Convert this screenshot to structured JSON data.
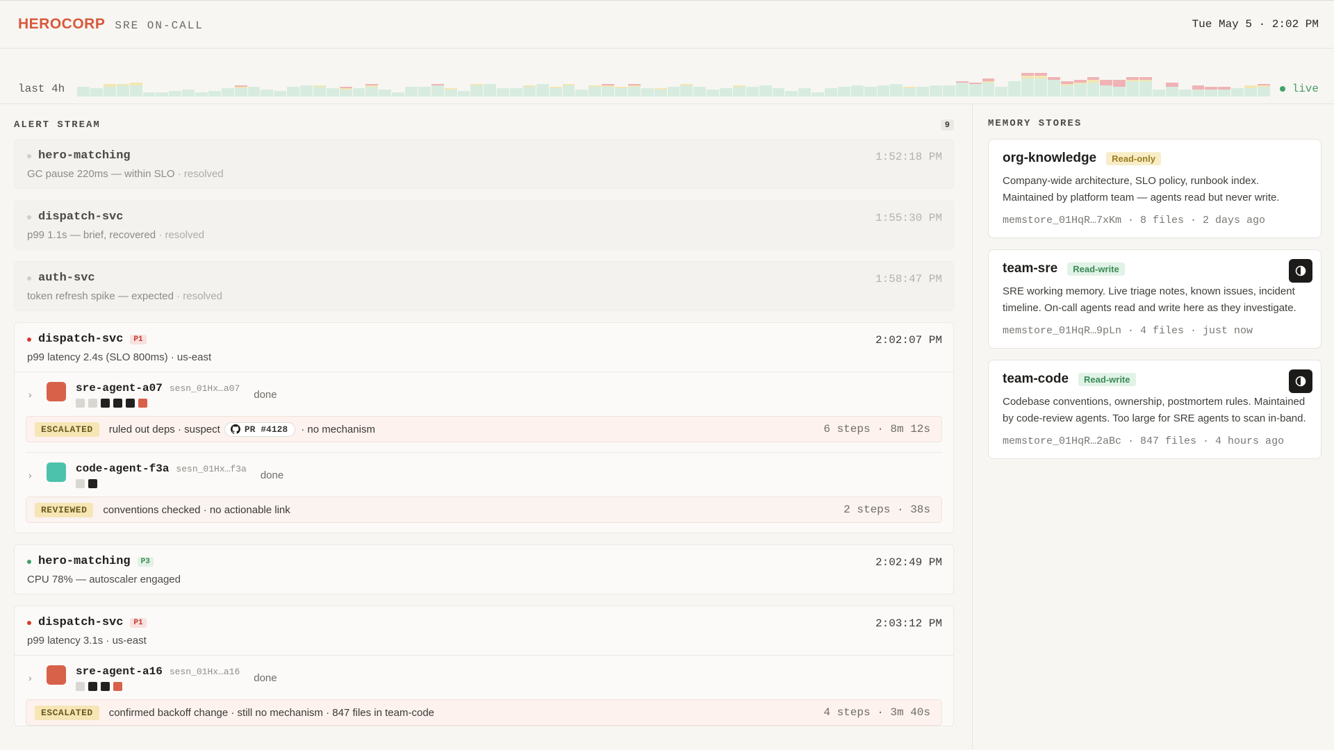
{
  "header": {
    "brand": "HEROCORP",
    "subtitle": "SRE ON-CALL",
    "clock": "Tue May 5 · 2:02 PM"
  },
  "sparkline": {
    "label": "last 4h",
    "live_label": "live",
    "colors": {
      "ok": "#d7ecdf",
      "warn": "#f3e6b3",
      "crit": "#efb3b6"
    },
    "bars": [
      [
        14,
        0,
        0
      ],
      [
        12,
        0,
        0
      ],
      [
        14,
        4,
        0
      ],
      [
        16,
        2,
        0
      ],
      [
        16,
        4,
        0
      ],
      [
        6,
        0,
        0
      ],
      [
        6,
        0,
        0
      ],
      [
        8,
        0,
        0
      ],
      [
        10,
        0,
        0
      ],
      [
        6,
        0,
        0
      ],
      [
        8,
        0,
        0
      ],
      [
        12,
        0,
        0
      ],
      [
        12,
        2,
        2
      ],
      [
        14,
        0,
        0
      ],
      [
        10,
        0,
        0
      ],
      [
        8,
        0,
        0
      ],
      [
        14,
        0,
        0
      ],
      [
        16,
        0,
        0
      ],
      [
        14,
        2,
        0
      ],
      [
        12,
        0,
        0
      ],
      [
        10,
        2,
        2
      ],
      [
        12,
        0,
        0
      ],
      [
        14,
        2,
        2
      ],
      [
        10,
        0,
        0
      ],
      [
        6,
        0,
        0
      ],
      [
        14,
        0,
        0
      ],
      [
        14,
        0,
        0
      ],
      [
        16,
        0,
        2
      ],
      [
        10,
        2,
        0
      ],
      [
        8,
        0,
        0
      ],
      [
        16,
        2,
        0
      ],
      [
        18,
        0,
        0
      ],
      [
        12,
        0,
        0
      ],
      [
        12,
        0,
        0
      ],
      [
        14,
        2,
        0
      ],
      [
        18,
        0,
        0
      ],
      [
        12,
        2,
        0
      ],
      [
        16,
        2,
        0
      ],
      [
        10,
        0,
        0
      ],
      [
        14,
        2,
        0
      ],
      [
        14,
        2,
        2
      ],
      [
        12,
        2,
        0
      ],
      [
        14,
        2,
        2
      ],
      [
        12,
        0,
        0
      ],
      [
        10,
        2,
        0
      ],
      [
        14,
        0,
        0
      ],
      [
        16,
        2,
        0
      ],
      [
        14,
        0,
        0
      ],
      [
        10,
        0,
        0
      ],
      [
        12,
        0,
        0
      ],
      [
        14,
        2,
        0
      ],
      [
        14,
        0,
        0
      ],
      [
        16,
        0,
        0
      ],
      [
        12,
        0,
        0
      ],
      [
        8,
        0,
        0
      ],
      [
        12,
        0,
        0
      ],
      [
        6,
        0,
        0
      ],
      [
        12,
        0,
        0
      ],
      [
        14,
        0,
        0
      ],
      [
        16,
        0,
        0
      ],
      [
        14,
        0,
        0
      ],
      [
        16,
        0,
        0
      ],
      [
        18,
        0,
        0
      ],
      [
        12,
        2,
        0
      ],
      [
        14,
        0,
        0
      ],
      [
        16,
        0,
        0
      ],
      [
        16,
        0,
        0
      ],
      [
        20,
        0,
        2
      ],
      [
        18,
        0,
        2
      ],
      [
        20,
        2,
        4
      ],
      [
        14,
        0,
        0
      ],
      [
        22,
        0,
        0
      ],
      [
        26,
        4,
        4
      ],
      [
        26,
        4,
        4
      ],
      [
        24,
        0,
        4
      ],
      [
        16,
        2,
        4
      ],
      [
        18,
        2,
        4
      ],
      [
        20,
        4,
        4
      ],
      [
        16,
        0,
        8
      ],
      [
        14,
        0,
        10
      ],
      [
        22,
        2,
        4
      ],
      [
        22,
        2,
        4
      ],
      [
        10,
        0,
        0
      ],
      [
        14,
        0,
        6
      ],
      [
        10,
        0,
        0
      ],
      [
        10,
        0,
        6
      ],
      [
        10,
        0,
        4
      ],
      [
        10,
        0,
        4
      ],
      [
        12,
        0,
        0
      ],
      [
        12,
        4,
        0
      ],
      [
        14,
        2,
        2
      ]
    ]
  },
  "alert_stream": {
    "title": "ALERT STREAM",
    "count": "9",
    "alerts": [
      {
        "service": "hero-matching",
        "desc": "GC pause 220ms — within SLO",
        "resolved": "· resolved",
        "time": "1:52:18 PM"
      },
      {
        "service": "dispatch-svc",
        "desc": "p99 1.1s — brief, recovered",
        "resolved": "· resolved",
        "time": "1:55:30 PM"
      },
      {
        "service": "auth-svc",
        "desc": "token refresh spike — expected",
        "resolved": "· resolved",
        "time": "1:58:47 PM"
      },
      {
        "service": "dispatch-svc",
        "priority": "P1",
        "desc": "p99 latency 2.4s (SLO 800ms) · us-east",
        "time": "2:02:07 PM",
        "agents": [
          {
            "name": "sre-agent-a07",
            "session": "sesn_01Hx…a07",
            "status": "done",
            "verdict": "ESCALATED",
            "summary_before": "ruled out deps · suspect",
            "pr": "PR #4128",
            "summary_after": "· no mechanism",
            "stats": "6 steps · 8m 12s"
          },
          {
            "name": "code-agent-f3a",
            "session": "sesn_01Hx…f3a",
            "status": "done",
            "verdict": "REVIEWED",
            "summary": "conventions checked · no actionable link",
            "stats": "2 steps · 38s"
          }
        ]
      },
      {
        "service": "hero-matching",
        "priority": "P3",
        "desc": "CPU 78% — autoscaler engaged",
        "time": "2:02:49 PM"
      },
      {
        "service": "dispatch-svc",
        "priority": "P1",
        "desc": "p99 latency 3.1s · us-east",
        "time": "2:03:12 PM",
        "agents": [
          {
            "name": "sre-agent-a16",
            "session": "sesn_01Hx…a16",
            "status": "done",
            "verdict": "ESCALATED",
            "summary": "confirmed backoff change · still no mechanism · 847 files in team-code",
            "stats": "4 steps · 3m 40s"
          }
        ]
      }
    ]
  },
  "memory_stores": {
    "title": "MEMORY STORES",
    "stores": [
      {
        "name": "org-knowledge",
        "access": "Read-only",
        "desc": "Company-wide architecture, SLO policy, runbook index. Maintained by platform team — agents read but never write.",
        "meta": "memstore_01HqR…7xKm · 8 files · 2 days ago"
      },
      {
        "name": "team-sre",
        "access": "Read-write",
        "desc": "SRE working memory. Live triage notes, known issues, incident timeline. On-call agents read and write here as they investigate.",
        "meta": "memstore_01HqR…9pLn · 4 files · just now"
      },
      {
        "name": "team-code",
        "access": "Read-write",
        "desc": "Codebase conventions, ownership, postmortem rules. Maintained by code-review agents. Too large for SRE agents to scan in-band.",
        "meta": "memstore_01HqR…2aBc · 847 files · 4 hours ago"
      }
    ]
  }
}
